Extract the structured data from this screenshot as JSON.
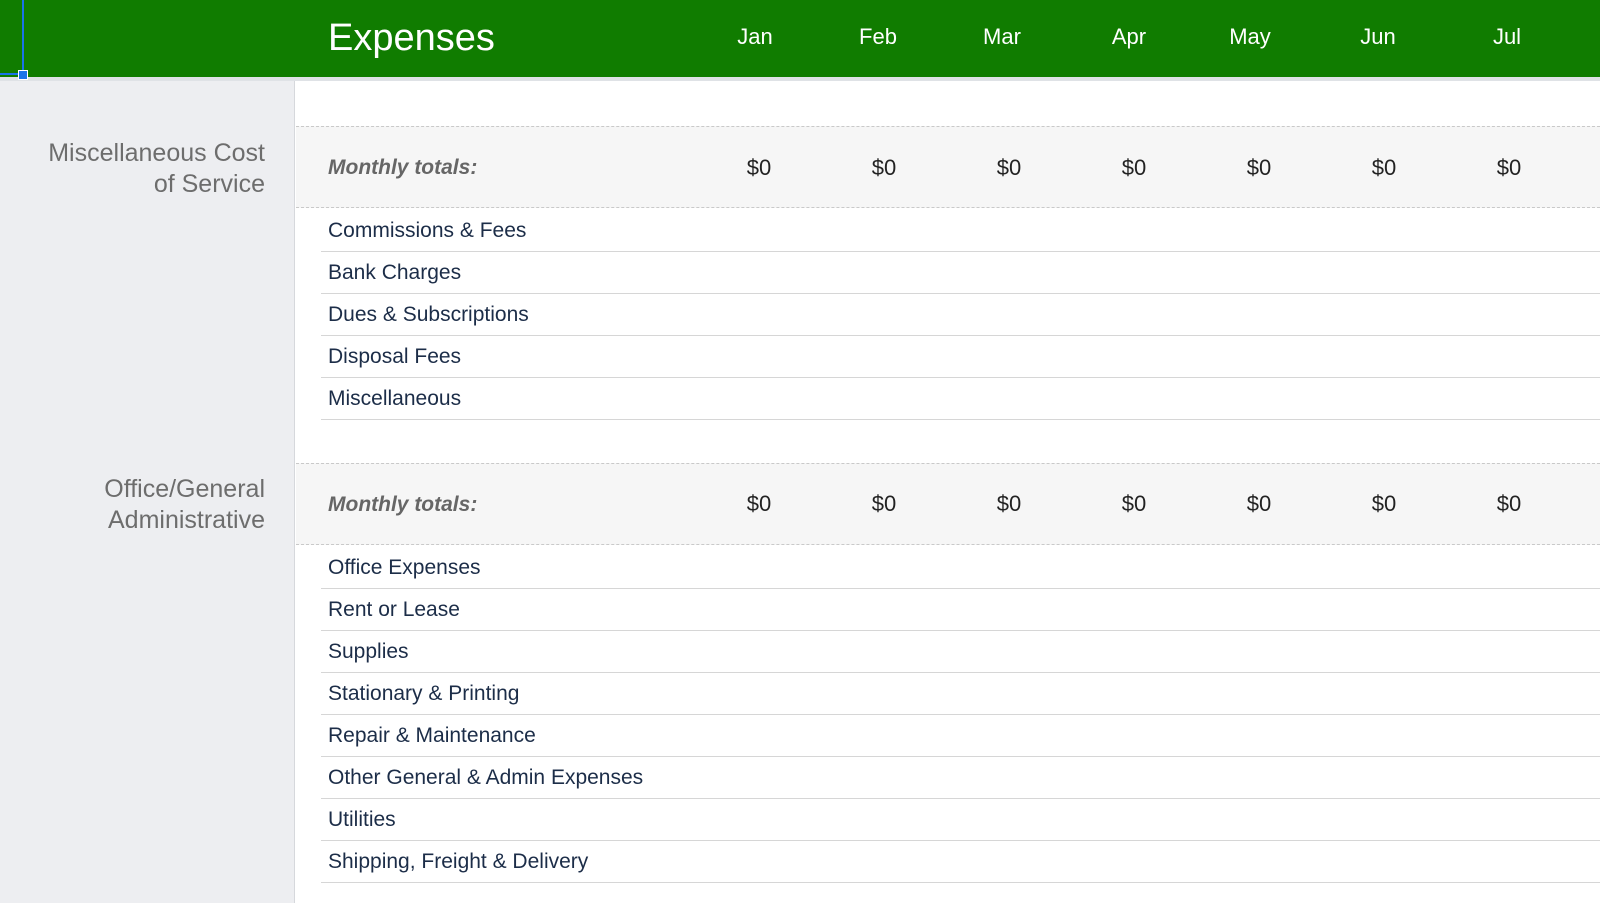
{
  "header": {
    "title": "Expenses",
    "months": [
      "Jan",
      "Feb",
      "Mar",
      "Apr",
      "May",
      "Jun",
      "Jul"
    ]
  },
  "sections": [
    {
      "label_lines": [
        "Miscellaneous Cost",
        "of Service"
      ],
      "totals_label": "Monthly totals:",
      "totals": [
        "$0",
        "$0",
        "$0",
        "$0",
        "$0",
        "$0",
        "$0"
      ],
      "items": [
        "Commissions & Fees",
        "Bank Charges",
        "Dues & Subscriptions",
        "Disposal Fees",
        "Miscellaneous"
      ]
    },
    {
      "label_lines": [
        "Office/General",
        "Administrative"
      ],
      "totals_label": "Monthly totals:",
      "totals": [
        "$0",
        "$0",
        "$0",
        "$0",
        "$0",
        "$0",
        "$0"
      ],
      "items": [
        "Office Expenses",
        "Rent or Lease",
        "Supplies",
        "Stationary & Printing",
        "Repair & Maintenance",
        "Other General & Admin Expenses",
        "Utilities",
        "Shipping, Freight & Delivery"
      ]
    }
  ],
  "colors": {
    "header_bg": "#107C00",
    "sidebar_bg": "#edeef1",
    "selection": "#1a73e8",
    "row_text": "#1c2d48"
  }
}
